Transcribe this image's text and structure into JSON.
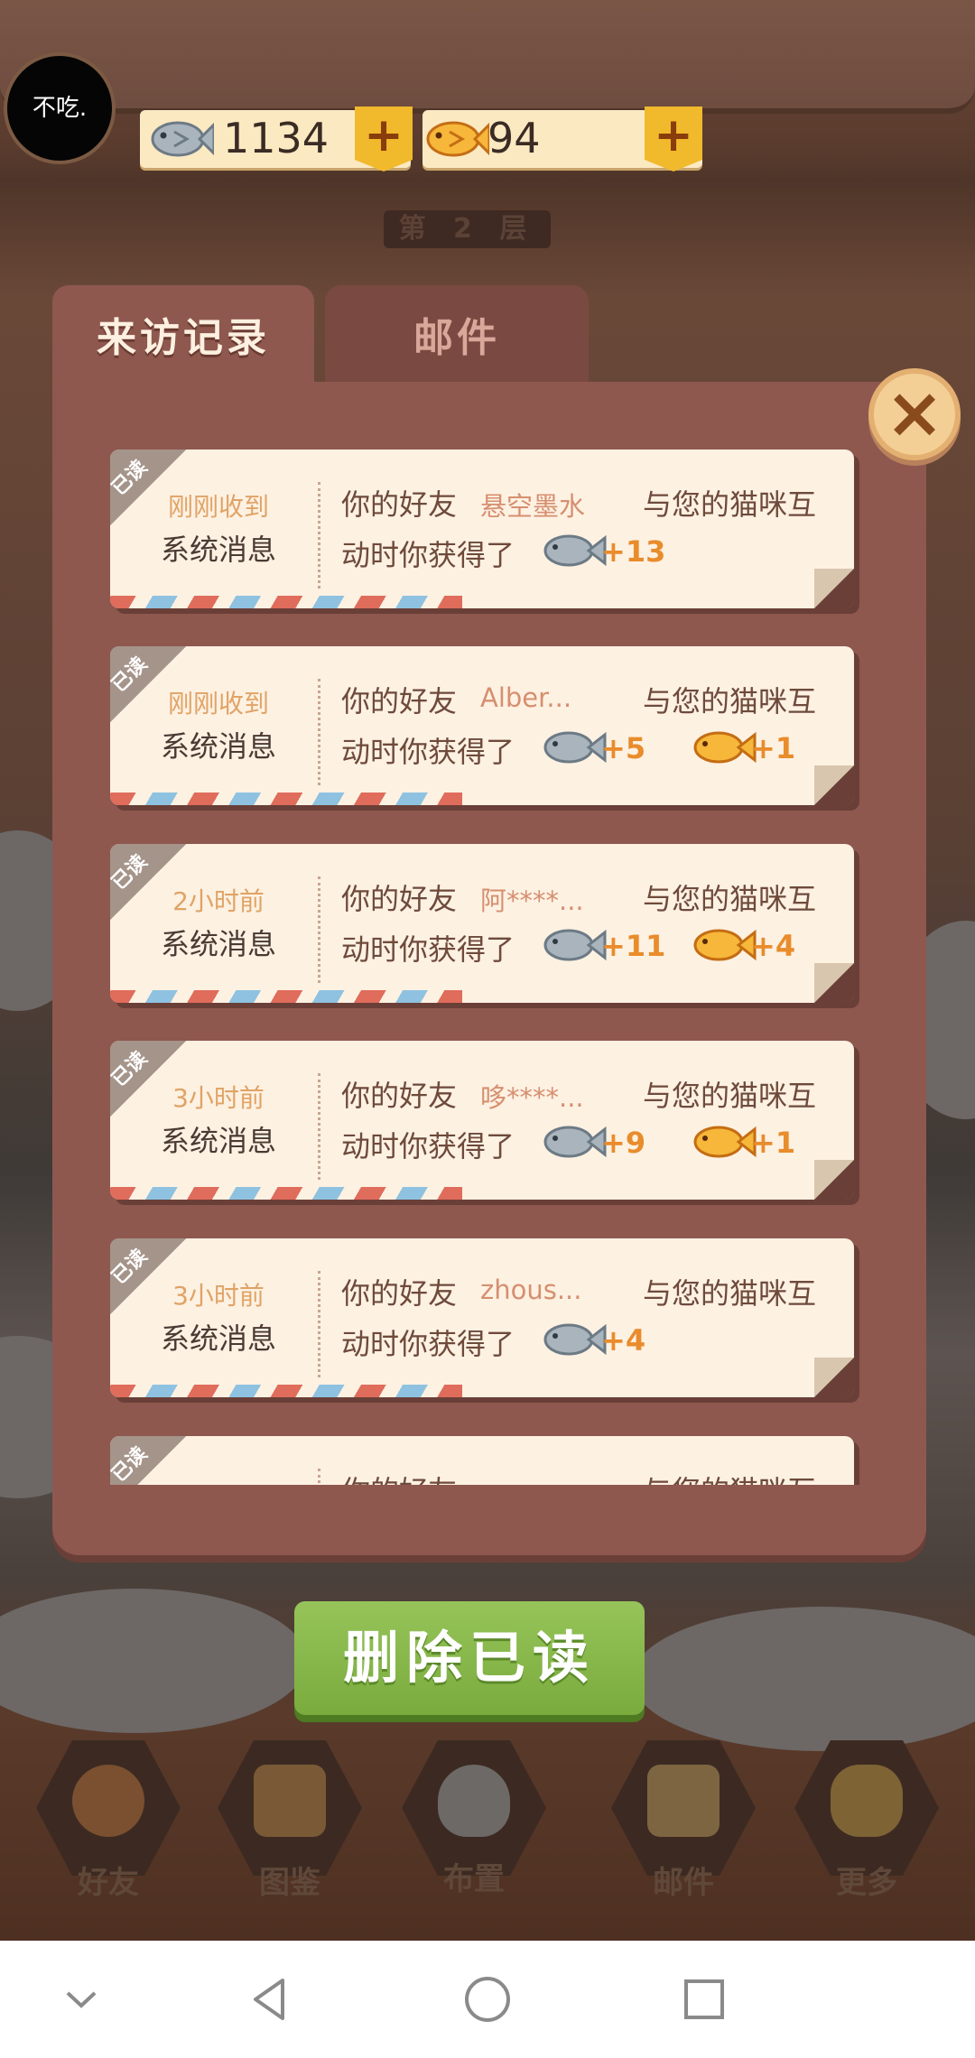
{
  "avatar": {
    "text": "不吃."
  },
  "currencies": {
    "silver_fish": {
      "value": "1134",
      "icon": "silver-fish-icon",
      "plus": "+"
    },
    "gold_fish": {
      "value": "94",
      "icon": "gold-fish-icon",
      "plus": "+"
    }
  },
  "floor_label": "第 2 层",
  "tabs": [
    {
      "label": "来访记录",
      "active": true
    },
    {
      "label": "邮件",
      "active": false
    }
  ],
  "close_icon": "×",
  "messages": [
    {
      "badge": "已读",
      "time": "刚刚收到",
      "source": "系统消息",
      "prefix": "你的好友",
      "name": "悬空墨水",
      "suffix": "与您的猫咪互",
      "line2": "动时你获得了",
      "rewards": [
        {
          "type": "silver",
          "amount": "+13"
        }
      ]
    },
    {
      "badge": "已读",
      "time": "刚刚收到",
      "source": "系统消息",
      "prefix": "你的好友",
      "name": "Alber...",
      "suffix": "与您的猫咪互",
      "line2": "动时你获得了",
      "rewards": [
        {
          "type": "silver",
          "amount": "+5"
        },
        {
          "type": "gold",
          "amount": "+1"
        }
      ]
    },
    {
      "badge": "已读",
      "time": "2小时前",
      "source": "系统消息",
      "prefix": "你的好友",
      "name": "阿****...",
      "suffix": "与您的猫咪互",
      "line2": "动时你获得了",
      "rewards": [
        {
          "type": "silver",
          "amount": "+11"
        },
        {
          "type": "gold",
          "amount": "+4"
        }
      ]
    },
    {
      "badge": "已读",
      "time": "3小时前",
      "source": "系统消息",
      "prefix": "你的好友",
      "name": "哆****...",
      "suffix": "与您的猫咪互",
      "line2": "动时你获得了",
      "rewards": [
        {
          "type": "silver",
          "amount": "+9"
        },
        {
          "type": "gold",
          "amount": "+1"
        }
      ]
    },
    {
      "badge": "已读",
      "time": "3小时前",
      "source": "系统消息",
      "prefix": "你的好友",
      "name": "zhous...",
      "suffix": "与您的猫咪互",
      "line2": "动时你获得了",
      "rewards": [
        {
          "type": "silver",
          "amount": "+4"
        }
      ]
    },
    {
      "badge": "已读",
      "time": "",
      "source": "",
      "prefix": "你的好友",
      "name": "",
      "suffix": "与您的猫咪互",
      "line2": "",
      "rewards": []
    }
  ],
  "delete_button": "删除已读",
  "bottom_nav": [
    {
      "label": "好友",
      "icon": "friends-icon"
    },
    {
      "label": "图鉴",
      "icon": "album-icon"
    },
    {
      "label": "布置",
      "icon": "decorate-icon"
    },
    {
      "label": "邮件",
      "icon": "mail-icon"
    },
    {
      "label": "更多",
      "icon": "more-icon"
    }
  ],
  "system_nav": [
    "collapse-icon",
    "back-icon",
    "home-icon",
    "recents-icon"
  ],
  "colors": {
    "panel": "#8e584f",
    "card": "#fdf1e2",
    "reward": "#e98c2c",
    "delete": "#8ab94c",
    "close": "#f3cf95"
  }
}
